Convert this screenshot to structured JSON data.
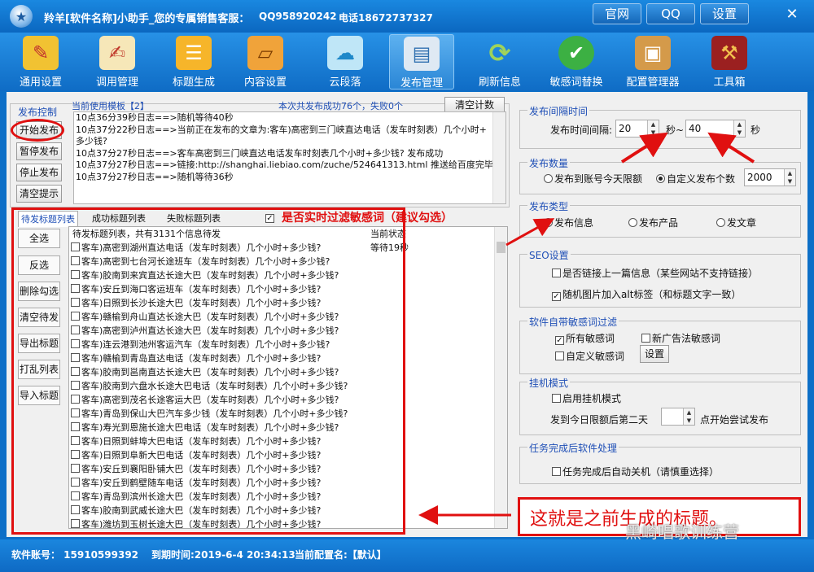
{
  "window": {
    "title": "羚羊[软件名称]小助手_您的专属销售客服：",
    "qq": "QQ958920242",
    "phone": "电话18672737327",
    "links": [
      "官网",
      "QQ",
      "设置"
    ],
    "close": "✕"
  },
  "toolbar": [
    "通用设置",
    "调用管理",
    "标题生成",
    "内容设置",
    "云段落",
    "发布管理",
    "刷新信息",
    "敏感词替换",
    "配置管理器",
    "工具箱"
  ],
  "control": {
    "title": "发布控制",
    "template": "当前使用模板【2】",
    "stats": "本次共发布成功76个，失败0个",
    "clear_count": "清空计数",
    "buttons": [
      "开始发布",
      "暂停发布",
      "停止发布",
      "清空提示"
    ],
    "log": [
      "10点36分39秒日志==>随机等待40秒",
      "10点37分22秒日志==>当前正在发布的文章为:客车)高密到三门峡直达电话（发车时刻表）几个小时+",
      "多少钱?",
      "10点37分27秒日志==>客车高密到三门峡直达电话发车时刻表几个小时+多少钱? 发布成功",
      "10点37分27秒日志==>链接:http://shanghai.liebiao.com/zuche/524641313.html 推送给百度完毕",
      "10点37分27秒日志==>随机等待36秒"
    ]
  },
  "tabs": [
    "待发标题列表",
    "成功标题列表",
    "失败标题列表"
  ],
  "filter_label": "是否实时过滤敏感词（建议勾选）",
  "list": {
    "header": "待发标题列表，共有3131个信息待发",
    "status_header": "当前状态",
    "first_status": "等待19秒",
    "actions": [
      "全选",
      "反选",
      "删除勾选",
      "清空待发",
      "导出标题",
      "打乱列表",
      "导入标题"
    ],
    "rows": [
      "客车)高密到湖州直达电话（发车时刻表）几个小时+多少钱?",
      "客车)高密到七台河长途班车（发车时刻表）几个小时+多少钱?",
      "客车)胶南到来宾直达长途大巴（发车时刻表）几个小时+多少钱?",
      "客车)安丘到海口客运班车（发车时刻表）几个小时+多少钱?",
      "客车)日照到长沙长途大巴（发车时刻表）几个小时+多少钱?",
      "客车)赣榆到舟山直达长途大巴（发车时刻表）几个小时+多少钱?",
      "客车)高密到泸州直达长途大巴（发车时刻表）几个小时+多少钱?",
      "客车)连云港到池州客运汽车（发车时刻表）几个小时+多少钱?",
      "客车)赣榆到青岛直达电话（发车时刻表）几个小时+多少钱?",
      "客车)胶南到邕南直达长途大巴（发车时刻表）几个小时+多少钱?",
      "客车)胶南到六盘水长途大巴电话（发车时刻表）几个小时+多少钱?",
      "客车)高密到茂名长途客运大巴（发车时刻表）几个小时+多少钱?",
      "客车)青岛到保山大巴汽车多少钱（发车时刻表）几个小时+多少钱?",
      "客车)寿光到恩施长途大巴电话（发车时刻表）几个小时+多少钱?",
      "客车)日照到蚌埠大巴电话（发车时刻表）几个小时+多少钱?",
      "客车)日照到阜新大巴电话（发车时刻表）几个小时+多少钱?",
      "客车)安丘到襄阳卧铺大巴（发车时刻表）几个小时+多少钱?",
      "客车)安丘到鹤壁随车电话（发车时刻表）几个小时+多少钱?",
      "客车)青岛到滨州长途大巴（发车时刻表）几个小时+多少钱?",
      "客车)胶南到武威长途大巴（发车时刻表）几个小时+多少钱?",
      "客车)潍坊到玉树长途大巴（发车时刻表）几个小时+多少钱?"
    ]
  },
  "interval": {
    "title": "发布间隔时间",
    "label": "发布时间间隔:",
    "min": "20",
    "sep": "秒~",
    "max": "40",
    "unit": "秒"
  },
  "quantity": {
    "title": "发布数量",
    "opt1": "发布到账号今天限额",
    "opt2": "自定义发布个数",
    "value": "2000"
  },
  "type": {
    "title": "发布类型",
    "opts": [
      "发布信息",
      "发布产品",
      "发文章"
    ]
  },
  "seo": {
    "title": "SEO设置",
    "opt1": "是否链接上一篇信息（某些网站不支持链接）",
    "opt2": "随机图片加入alt标签（和标题文字一致）"
  },
  "sensitive": {
    "title": "软件自带敏感词过滤",
    "opt1": "所有敏感词",
    "opt2": "新广告法敏感词",
    "opt3": "自定义敏感词",
    "btn": "设置"
  },
  "hangup": {
    "title": "挂机模式",
    "opt": "启用挂机模式",
    "label1": "发到今日限额后第二天",
    "label2": "点开始尝试发布"
  },
  "finish": {
    "title": "任务完成后软件处理",
    "opt": "任务完成后自动关机（请慎重选择）"
  },
  "annotation": "这就是之前生成的标题。",
  "watermark": "黑崎唱歌训练营",
  "status": {
    "account": "软件账号：  15910599392",
    "expiry": "到期时间:2019-6-4  20:34:13",
    "config": "当前配置名:【默认】"
  }
}
